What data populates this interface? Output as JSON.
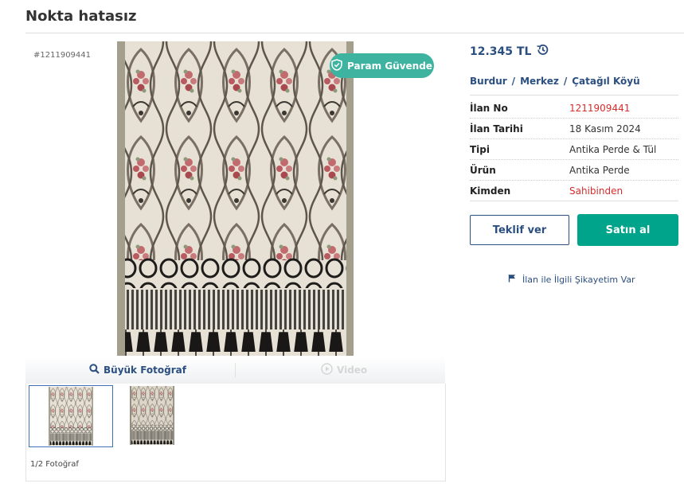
{
  "listing": {
    "title": "Nokta hatasız"
  },
  "gallery": {
    "ad_id_text": "#1211909441",
    "safe_badge": "Param Güvende",
    "large_photo_label": "Büyük Fotoğraf",
    "video_label": "Video",
    "photo_count": "1/2 Fotoğraf"
  },
  "info": {
    "price": "12.345 TL",
    "location": {
      "city": "Burdur",
      "district": "Merkez",
      "neighborhood": "Çatağıl Köyü",
      "separator": "/"
    },
    "details": [
      {
        "key": "İlan No",
        "value": "1211909441",
        "value_color": "#d62c2c"
      },
      {
        "key": "İlan Tarihi",
        "value": "18 Kasım 2024"
      },
      {
        "key": "Tipi",
        "value": "Antika Perde & Tül"
      },
      {
        "key": "Ürün",
        "value": "Antika Perde"
      },
      {
        "key": "Kimden",
        "value": "Sahibinden",
        "value_color": "#d62c2c"
      }
    ],
    "offer_button": "Teklif ver",
    "buy_button": "Satın al",
    "report_link": "İlan ile İlgili Şikayetim Var"
  },
  "icons": {
    "price_history": "history-icon",
    "safe": "shield-check-icon",
    "zoom": "magnifier-icon",
    "video": "play-circle-icon",
    "report": "flag-icon"
  },
  "colors": {
    "brand_blue": "#2b4f80",
    "teal": "#00a48b",
    "badge": "#3db3a0",
    "alert_red": "#d62c2c"
  }
}
